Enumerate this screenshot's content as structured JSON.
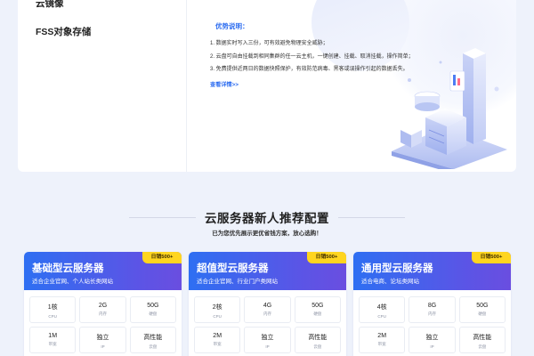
{
  "sidebar": {
    "items": [
      {
        "label": "云镜像"
      },
      {
        "label": "FSS对象存储"
      }
    ]
  },
  "advantages": {
    "title": "优势说明：",
    "items": [
      "1. 数据实时写入三份，可有效避免物理安全威胁；",
      "2. 云盘可自由挂载到相同集群的任一云主机，一键创建、挂载、取消挂载，操作简单；",
      "3. 免费提供近两日的数据快照保护，有效防范病毒、黑客或误操作引起的数据丢失。"
    ],
    "detail_link": "查看详情>>"
  },
  "section": {
    "title": "云服务器新人推荐配置",
    "subtitle": "已为您优先展示更优省钱方案，放心选购！"
  },
  "cards": [
    {
      "name": "基础型云服务器",
      "desc": "适合企业官网、个人站长类网站",
      "badge": "日销500+",
      "specs": [
        {
          "value": "1核",
          "unit": "CPU"
        },
        {
          "value": "2G",
          "unit": "内存"
        },
        {
          "value": "50G",
          "unit": "硬盘"
        },
        {
          "value": "1M",
          "unit": "带宽"
        },
        {
          "value": "独立",
          "unit": "IP"
        },
        {
          "value": "高性能",
          "unit": "云盘"
        }
      ]
    },
    {
      "name": "超值型云服务器",
      "desc": "适合企业官网、行业门户类网站",
      "badge": "日销500+",
      "specs": [
        {
          "value": "2核",
          "unit": "CPU"
        },
        {
          "value": "4G",
          "unit": "内存"
        },
        {
          "value": "50G",
          "unit": "硬盘"
        },
        {
          "value": "2M",
          "unit": "带宽"
        },
        {
          "value": "独立",
          "unit": "IP"
        },
        {
          "value": "高性能",
          "unit": "云盘"
        }
      ]
    },
    {
      "name": "通用型云服务器",
      "desc": "适合电商、论坛类网站",
      "badge": "日销500+",
      "specs": [
        {
          "value": "4核",
          "unit": "CPU"
        },
        {
          "value": "8G",
          "unit": "内存"
        },
        {
          "value": "50G",
          "unit": "硬盘"
        },
        {
          "value": "2M",
          "unit": "带宽"
        },
        {
          "value": "独立",
          "unit": "IP"
        },
        {
          "value": "高性能",
          "unit": "云盘"
        }
      ]
    }
  ],
  "colors": {
    "accent": "#2c6cf0",
    "card_gradient_start": "#2e6ff2",
    "card_gradient_end": "#6a4ee0",
    "badge": "#ffd51f",
    "page_background": "#eef2fb"
  }
}
